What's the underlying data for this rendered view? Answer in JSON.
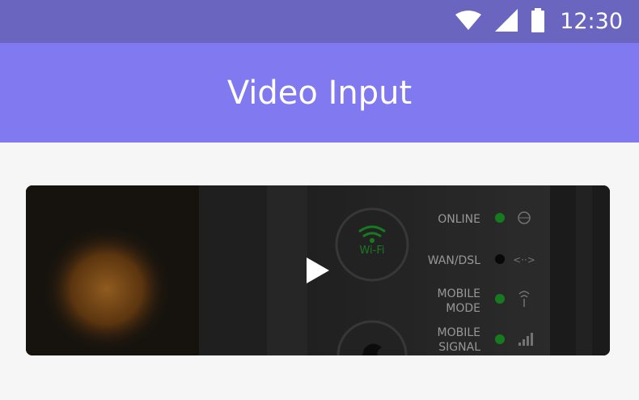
{
  "status_bar": {
    "time": "12:30",
    "icons": [
      "wifi-icon",
      "cell-signal-icon",
      "battery-icon"
    ]
  },
  "app_bar": {
    "title": "Video Input"
  },
  "video": {
    "device_labels": {
      "wifi_button": "Wi-Fi",
      "online": "ONLINE",
      "wan_dsl": "WAN/DSL",
      "mobile_mode_line1": "MOBILE",
      "mobile_mode_line2": "MODE",
      "mobile_signal_line1": "MOBILE",
      "mobile_signal_line2": "SIGNAL"
    },
    "play_icon": "play-icon"
  },
  "colors": {
    "status_bar": "#6a66c0",
    "app_bar": "#8079f0",
    "background": "#f6f6f6",
    "led_green": "#1fa32a"
  }
}
